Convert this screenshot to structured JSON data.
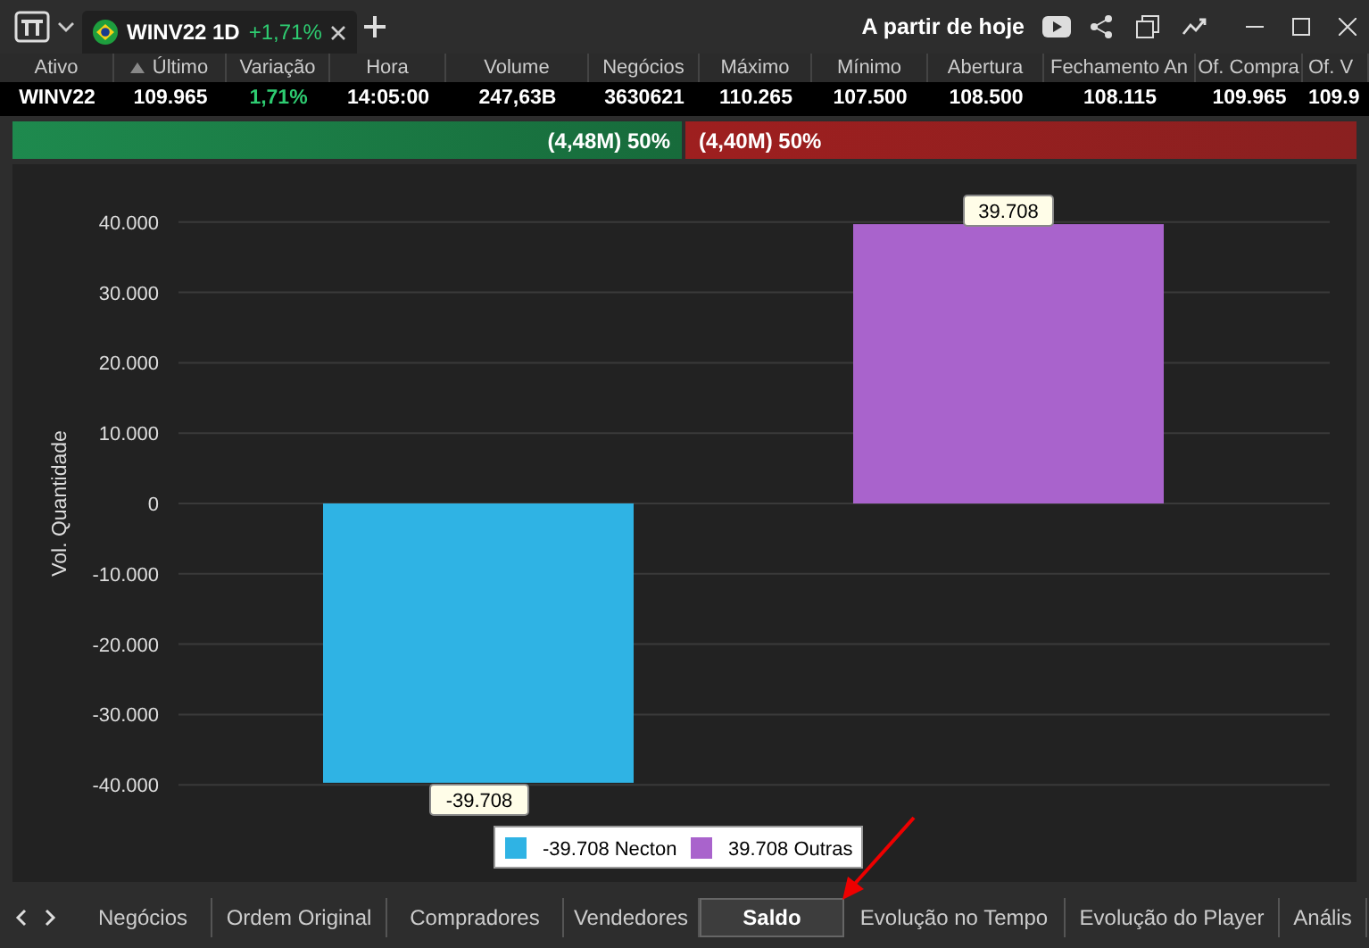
{
  "title_bar": {
    "tab": {
      "symbol": "WINV22 1D",
      "change": "+1,71%"
    },
    "period": "A partir de hoje"
  },
  "quote_table": {
    "columns": [
      {
        "label": "Ativo",
        "sorted": false
      },
      {
        "label": "Último",
        "sorted": true
      },
      {
        "label": "Variação",
        "sorted": false
      },
      {
        "label": "Hora",
        "sorted": false
      },
      {
        "label": "Volume",
        "sorted": false
      },
      {
        "label": "Negócios",
        "sorted": false
      },
      {
        "label": "Máximo",
        "sorted": false
      },
      {
        "label": "Mínimo",
        "sorted": false
      },
      {
        "label": "Abertura",
        "sorted": false
      },
      {
        "label": "Fechamento An",
        "sorted": false
      },
      {
        "label": "Of. Compra",
        "sorted": false
      },
      {
        "label": "Of. V",
        "sorted": false
      }
    ],
    "row": [
      {
        "text": "WINV22",
        "kind": "plain"
      },
      {
        "text": "109.965",
        "kind": "plain"
      },
      {
        "text": "1,71%",
        "kind": "up"
      },
      {
        "text": "14:05:00",
        "kind": "plain"
      },
      {
        "text": "247,63B",
        "kind": "plain"
      },
      {
        "text": "3630621",
        "kind": "plain"
      },
      {
        "text": "110.265",
        "kind": "plain"
      },
      {
        "text": "107.500",
        "kind": "plain"
      },
      {
        "text": "108.500",
        "kind": "plain"
      },
      {
        "text": "108.115",
        "kind": "plain"
      },
      {
        "text": "109.965",
        "kind": "plain"
      },
      {
        "text": "109.9",
        "kind": "plain"
      }
    ]
  },
  "balance": {
    "buy": {
      "text": "(4,48M) 50%"
    },
    "sell": {
      "text": "(4,40M) 50%"
    }
  },
  "chart": {
    "chart_data": {
      "type": "bar",
      "ylabel": "Vol. Quantidade",
      "grid": true,
      "series": [
        {
          "name": "Necton",
          "color": "#2fb3e4",
          "values": [
            -39708,
            null
          ]
        },
        {
          "name": "Outras",
          "color": "#a963cc",
          "values": [
            null,
            39708
          ]
        }
      ],
      "ylim": [
        -40000,
        40000
      ],
      "yticks": [
        {
          "value": 40000,
          "label": "40.000"
        },
        {
          "value": 30000,
          "label": "30.000"
        },
        {
          "value": 20000,
          "label": "20.000"
        },
        {
          "value": 10000,
          "label": "10.000"
        },
        {
          "value": 0,
          "label": "0"
        },
        {
          "value": -10000,
          "label": "-10.000"
        },
        {
          "value": -20000,
          "label": "-20.000"
        },
        {
          "value": -30000,
          "label": "-30.000"
        },
        {
          "value": -40000,
          "label": "-40.000"
        }
      ],
      "value_labels": [
        "-39.708",
        "39.708"
      ]
    }
  },
  "bottom_tabs": [
    {
      "label": "Negócios",
      "selected": false
    },
    {
      "label": "Ordem Original",
      "selected": false
    },
    {
      "label": "Compradores",
      "selected": false
    },
    {
      "label": "Vendedores",
      "selected": false
    },
    {
      "label": "Saldo",
      "selected": true
    },
    {
      "label": "Evolução no Tempo",
      "selected": false
    },
    {
      "label": "Evolução do Player",
      "selected": false
    },
    {
      "label": "Anális",
      "selected": false
    }
  ]
}
